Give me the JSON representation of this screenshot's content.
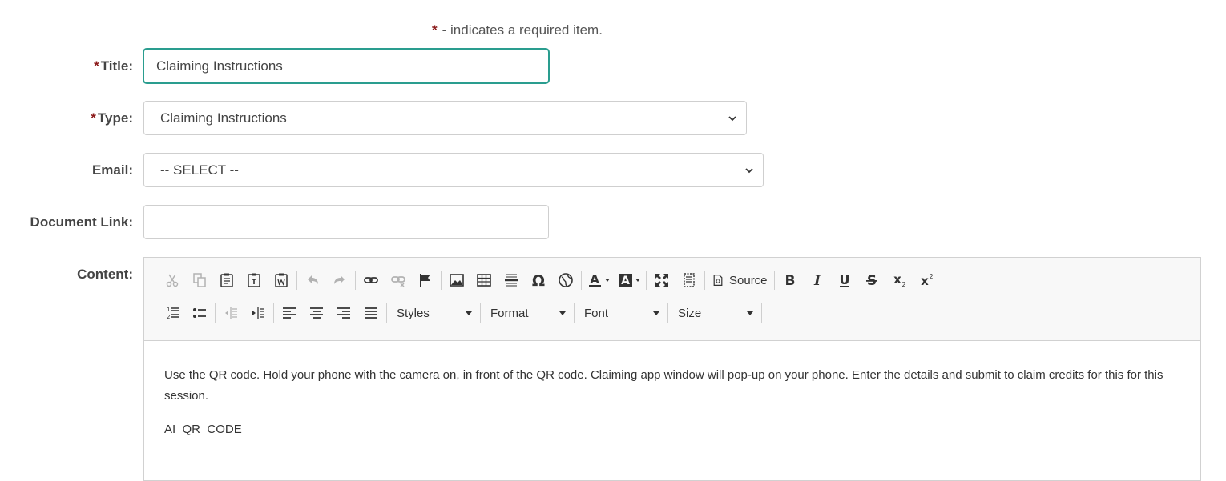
{
  "required_note": {
    "star": "*",
    "text": "- indicates a required item."
  },
  "form": {
    "title": {
      "star": "*",
      "label": "Title:",
      "value": "Claiming Instructions"
    },
    "type": {
      "star": "*",
      "label": "Type:",
      "value": "Claiming Instructions"
    },
    "email": {
      "label": "Email:",
      "value": "-- SELECT --"
    },
    "document_link": {
      "label": "Document Link:",
      "value": ""
    },
    "content": {
      "label": "Content:"
    }
  },
  "editor": {
    "toolbar": {
      "source_label": "Source",
      "styles_label": "Styles",
      "format_label": "Format",
      "font_label": "Font",
      "size_label": "Size"
    },
    "body": {
      "paragraph1": "Use the QR code. Hold your phone with the camera on, in front of the QR code. Claiming app window will pop-up on your phone. Enter the details and submit to claim credits for this for this session.",
      "paragraph2": "AI_QR_CODE"
    }
  },
  "colors": {
    "required_star": "#8b1a1a",
    "focus_border": "#2a9d8f"
  }
}
